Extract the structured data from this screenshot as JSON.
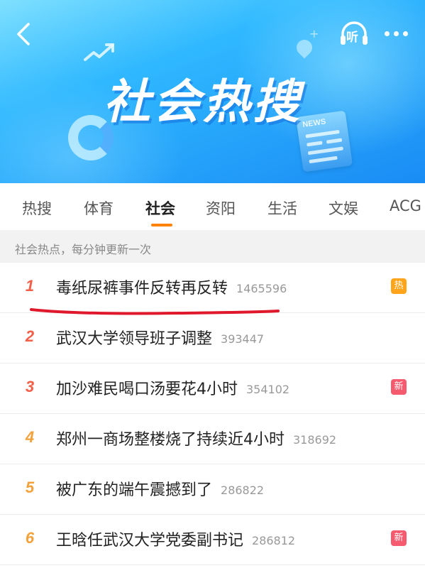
{
  "header": {
    "title": "社会热搜",
    "listen_label": "听",
    "news_label": "NEWS",
    "back_icon": "back-arrow-icon",
    "more_icon": "more-dots-icon"
  },
  "tabs": [
    {
      "label": "热搜",
      "active": false
    },
    {
      "label": "体育",
      "active": false
    },
    {
      "label": "社会",
      "active": true
    },
    {
      "label": "资阳",
      "active": false
    },
    {
      "label": "生活",
      "active": false
    },
    {
      "label": "文娱",
      "active": false
    },
    {
      "label": "ACG",
      "active": false
    }
  ],
  "subheader": "社会热点，每分钟更新一次",
  "items": [
    {
      "rank": "1",
      "title": "毒纸尿裤事件反转再反转",
      "count": "1465596",
      "badge": "热"
    },
    {
      "rank": "2",
      "title": "武汉大学领导班子调整",
      "count": "393447",
      "badge": ""
    },
    {
      "rank": "3",
      "title": "加沙难民喝口汤要花4小时",
      "count": "354102",
      "badge": "新"
    },
    {
      "rank": "4",
      "title": "郑州一商场整楼烧了持续近4小时",
      "count": "318692",
      "badge": ""
    },
    {
      "rank": "5",
      "title": "被广东的端午震撼到了",
      "count": "286822",
      "badge": ""
    },
    {
      "rank": "6",
      "title": "王晗任武汉大学党委副书记",
      "count": "286812",
      "badge": "新"
    }
  ],
  "colors": {
    "accent": "#ff8200",
    "rank_top": "#f2604a",
    "rank_mid": "#f3a23b",
    "badge_hot": "#ffa41b",
    "badge_new": "#f55a6f",
    "annotation": "#e0182c"
  }
}
